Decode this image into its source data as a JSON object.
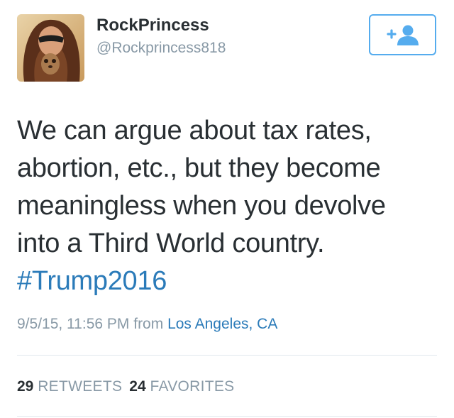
{
  "user": {
    "display_name": "RockPrincess",
    "handle": "@Rockprincess818",
    "avatar_icon": "profile-photo",
    "follow_icon": "add-user-icon"
  },
  "tweet": {
    "lines": [
      "We can argue about tax rates,",
      "abortion, etc., but they become",
      "meaningless when you devolve",
      "into a Third World country."
    ],
    "hashtag": "#Trump2016",
    "timestamp": "9/5/15, 11:56 PM",
    "from_label": "from",
    "location": "Los Angeles, CA"
  },
  "stats": {
    "retweets_count": "29",
    "retweets_label": "RETWEETS",
    "favorites_count": "24",
    "favorites_label": "FAVORITES"
  },
  "colors": {
    "accent": "#55acee",
    "link": "#2b7bb9",
    "muted": "#8899a6",
    "text": "#292f33"
  }
}
